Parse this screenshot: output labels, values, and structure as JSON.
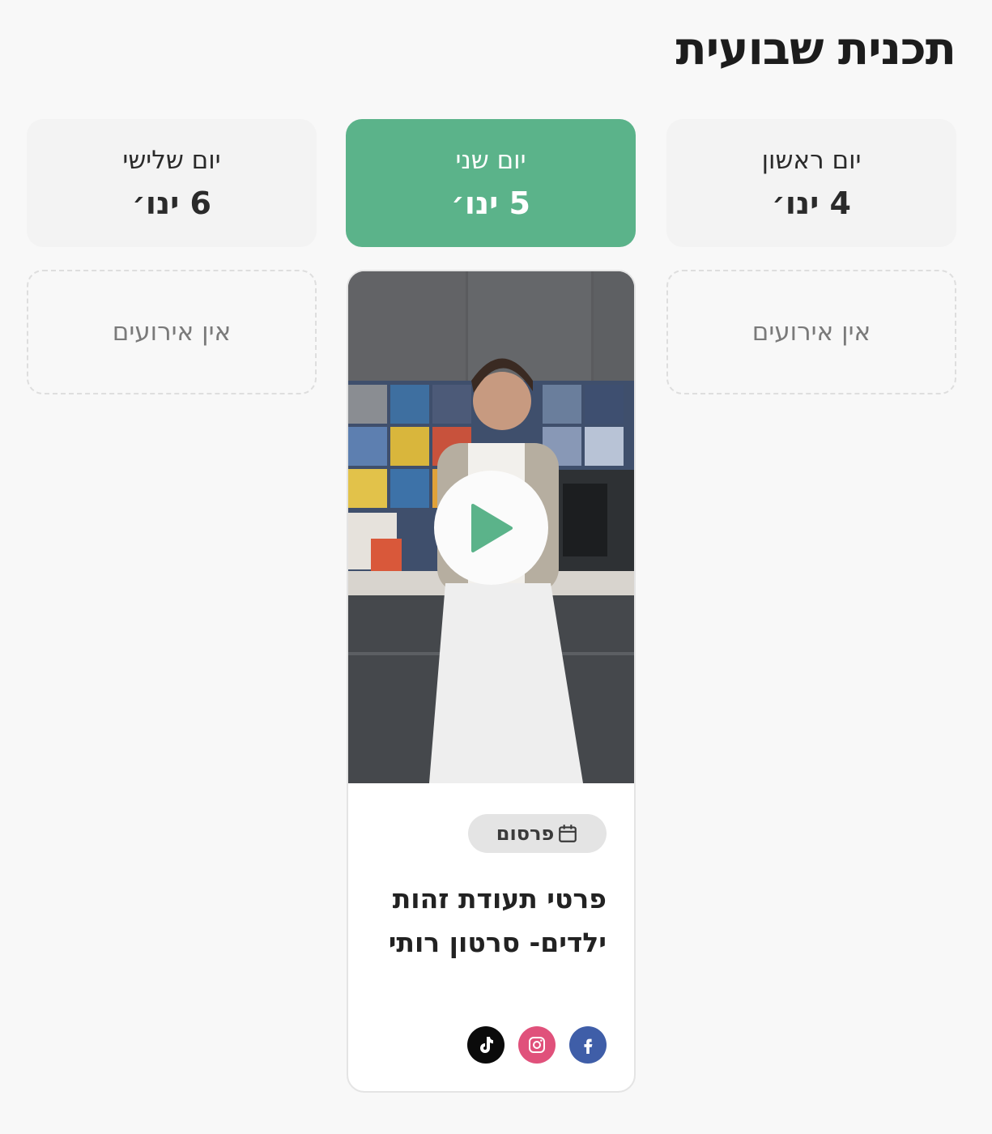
{
  "page": {
    "title": "תכנית שבועית"
  },
  "days": [
    {
      "name": "יום ראשון",
      "date": "4 ינו׳",
      "active": false,
      "empty_text": "אין אירועים"
    },
    {
      "name": "יום שני",
      "date": "5 ינו׳",
      "active": true
    },
    {
      "name": "יום שלישי",
      "date": "6 ינו׳",
      "active": false,
      "empty_text": "אין אירועים"
    }
  ],
  "event": {
    "badge_label": "פרסום",
    "badge_icon": "calendar-icon",
    "title": "פרטי תעודת זהות ילדים- סרטון רותי",
    "media_icon": "play-icon",
    "socials": [
      {
        "icon": "facebook-icon",
        "color": "#3f5ea8"
      },
      {
        "icon": "instagram-icon",
        "color": "#e0517b"
      },
      {
        "icon": "tiktok-icon",
        "color": "#0b0b0b"
      }
    ]
  },
  "colors": {
    "accent": "#5bb38a",
    "background": "#f8f8f8",
    "card_inactive": "#f3f3f3"
  }
}
